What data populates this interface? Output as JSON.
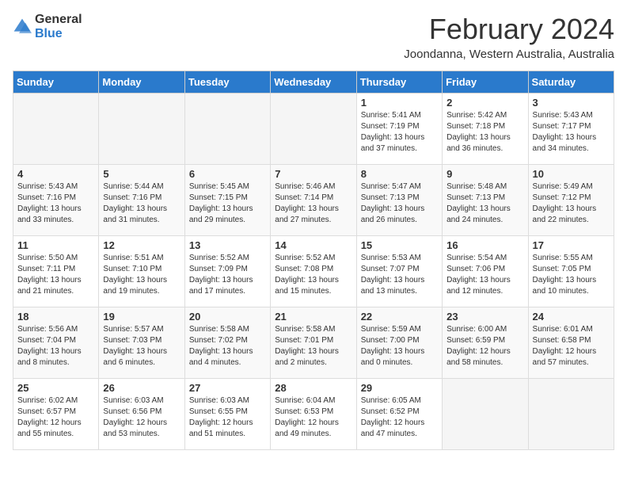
{
  "logo": {
    "general": "General",
    "blue": "Blue"
  },
  "header": {
    "month": "February 2024",
    "location": "Joondanna, Western Australia, Australia"
  },
  "weekdays": [
    "Sunday",
    "Monday",
    "Tuesday",
    "Wednesday",
    "Thursday",
    "Friday",
    "Saturday"
  ],
  "weeks": [
    [
      {
        "day": "",
        "info": ""
      },
      {
        "day": "",
        "info": ""
      },
      {
        "day": "",
        "info": ""
      },
      {
        "day": "",
        "info": ""
      },
      {
        "day": "1",
        "info": "Sunrise: 5:41 AM\nSunset: 7:19 PM\nDaylight: 13 hours\nand 37 minutes."
      },
      {
        "day": "2",
        "info": "Sunrise: 5:42 AM\nSunset: 7:18 PM\nDaylight: 13 hours\nand 36 minutes."
      },
      {
        "day": "3",
        "info": "Sunrise: 5:43 AM\nSunset: 7:17 PM\nDaylight: 13 hours\nand 34 minutes."
      }
    ],
    [
      {
        "day": "4",
        "info": "Sunrise: 5:43 AM\nSunset: 7:16 PM\nDaylight: 13 hours\nand 33 minutes."
      },
      {
        "day": "5",
        "info": "Sunrise: 5:44 AM\nSunset: 7:16 PM\nDaylight: 13 hours\nand 31 minutes."
      },
      {
        "day": "6",
        "info": "Sunrise: 5:45 AM\nSunset: 7:15 PM\nDaylight: 13 hours\nand 29 minutes."
      },
      {
        "day": "7",
        "info": "Sunrise: 5:46 AM\nSunset: 7:14 PM\nDaylight: 13 hours\nand 27 minutes."
      },
      {
        "day": "8",
        "info": "Sunrise: 5:47 AM\nSunset: 7:13 PM\nDaylight: 13 hours\nand 26 minutes."
      },
      {
        "day": "9",
        "info": "Sunrise: 5:48 AM\nSunset: 7:13 PM\nDaylight: 13 hours\nand 24 minutes."
      },
      {
        "day": "10",
        "info": "Sunrise: 5:49 AM\nSunset: 7:12 PM\nDaylight: 13 hours\nand 22 minutes."
      }
    ],
    [
      {
        "day": "11",
        "info": "Sunrise: 5:50 AM\nSunset: 7:11 PM\nDaylight: 13 hours\nand 21 minutes."
      },
      {
        "day": "12",
        "info": "Sunrise: 5:51 AM\nSunset: 7:10 PM\nDaylight: 13 hours\nand 19 minutes."
      },
      {
        "day": "13",
        "info": "Sunrise: 5:52 AM\nSunset: 7:09 PM\nDaylight: 13 hours\nand 17 minutes."
      },
      {
        "day": "14",
        "info": "Sunrise: 5:52 AM\nSunset: 7:08 PM\nDaylight: 13 hours\nand 15 minutes."
      },
      {
        "day": "15",
        "info": "Sunrise: 5:53 AM\nSunset: 7:07 PM\nDaylight: 13 hours\nand 13 minutes."
      },
      {
        "day": "16",
        "info": "Sunrise: 5:54 AM\nSunset: 7:06 PM\nDaylight: 13 hours\nand 12 minutes."
      },
      {
        "day": "17",
        "info": "Sunrise: 5:55 AM\nSunset: 7:05 PM\nDaylight: 13 hours\nand 10 minutes."
      }
    ],
    [
      {
        "day": "18",
        "info": "Sunrise: 5:56 AM\nSunset: 7:04 PM\nDaylight: 13 hours\nand 8 minutes."
      },
      {
        "day": "19",
        "info": "Sunrise: 5:57 AM\nSunset: 7:03 PM\nDaylight: 13 hours\nand 6 minutes."
      },
      {
        "day": "20",
        "info": "Sunrise: 5:58 AM\nSunset: 7:02 PM\nDaylight: 13 hours\nand 4 minutes."
      },
      {
        "day": "21",
        "info": "Sunrise: 5:58 AM\nSunset: 7:01 PM\nDaylight: 13 hours\nand 2 minutes."
      },
      {
        "day": "22",
        "info": "Sunrise: 5:59 AM\nSunset: 7:00 PM\nDaylight: 13 hours\nand 0 minutes."
      },
      {
        "day": "23",
        "info": "Sunrise: 6:00 AM\nSunset: 6:59 PM\nDaylight: 12 hours\nand 58 minutes."
      },
      {
        "day": "24",
        "info": "Sunrise: 6:01 AM\nSunset: 6:58 PM\nDaylight: 12 hours\nand 57 minutes."
      }
    ],
    [
      {
        "day": "25",
        "info": "Sunrise: 6:02 AM\nSunset: 6:57 PM\nDaylight: 12 hours\nand 55 minutes."
      },
      {
        "day": "26",
        "info": "Sunrise: 6:03 AM\nSunset: 6:56 PM\nDaylight: 12 hours\nand 53 minutes."
      },
      {
        "day": "27",
        "info": "Sunrise: 6:03 AM\nSunset: 6:55 PM\nDaylight: 12 hours\nand 51 minutes."
      },
      {
        "day": "28",
        "info": "Sunrise: 6:04 AM\nSunset: 6:53 PM\nDaylight: 12 hours\nand 49 minutes."
      },
      {
        "day": "29",
        "info": "Sunrise: 6:05 AM\nSunset: 6:52 PM\nDaylight: 12 hours\nand 47 minutes."
      },
      {
        "day": "",
        "info": ""
      },
      {
        "day": "",
        "info": ""
      }
    ]
  ]
}
